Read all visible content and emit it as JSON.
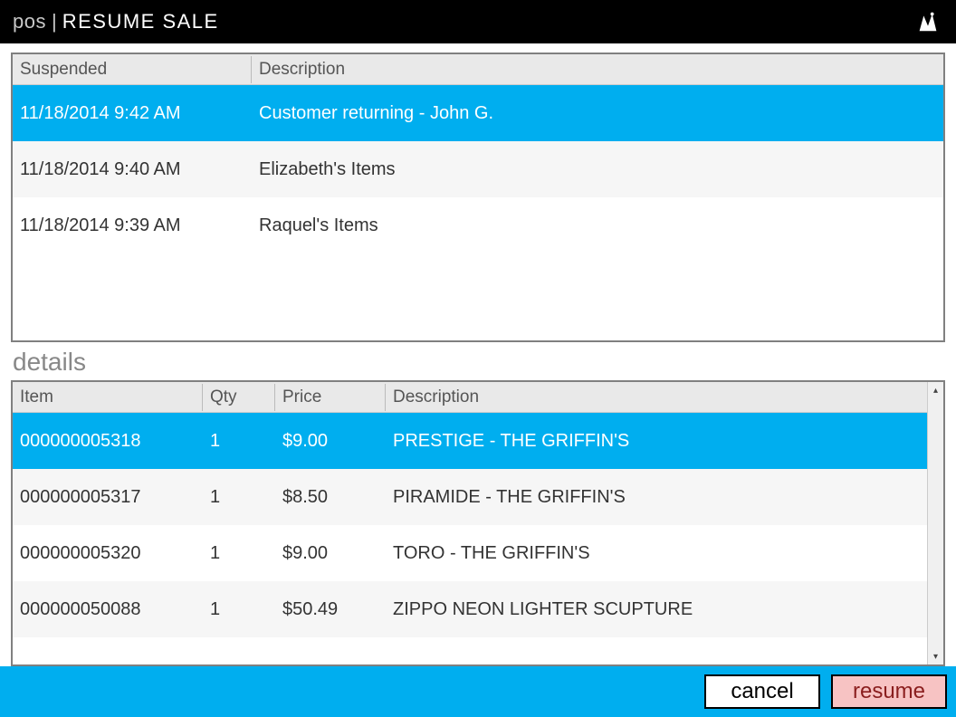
{
  "header": {
    "prefix": "pos",
    "separator": "|",
    "title": "RESUME SALE",
    "icon": "app-logo-icon"
  },
  "suspended_table": {
    "headers": {
      "suspended": "Suspended",
      "description": "Description"
    },
    "rows": [
      {
        "suspended": "11/18/2014 9:42 AM",
        "description": "Customer returning - John G.",
        "selected": true
      },
      {
        "suspended": "11/18/2014 9:40 AM",
        "description": "Elizabeth's Items",
        "selected": false
      },
      {
        "suspended": "11/18/2014 9:39 AM",
        "description": "Raquel's Items",
        "selected": false
      }
    ]
  },
  "details": {
    "label": "details",
    "headers": {
      "item": "Item",
      "qty": "Qty",
      "price": "Price",
      "description": "Description"
    },
    "rows": [
      {
        "item": "000000005318",
        "qty": "1",
        "price": "$9.00",
        "description": "PRESTIGE - THE GRIFFIN'S",
        "selected": true
      },
      {
        "item": "000000005317",
        "qty": "1",
        "price": "$8.50",
        "description": "PIRAMIDE - THE GRIFFIN'S",
        "selected": false
      },
      {
        "item": "000000005320",
        "qty": "1",
        "price": "$9.00",
        "description": "TORO - THE GRIFFIN'S",
        "selected": false
      },
      {
        "item": "000000050088",
        "qty": "1",
        "price": "$50.49",
        "description": "ZIPPO NEON LIGHTER SCUPTURE",
        "selected": false
      }
    ]
  },
  "actions": {
    "cancel": "cancel",
    "resume": "resume"
  },
  "colors": {
    "accent": "#00aeef",
    "resume_bg": "#f7c3c3",
    "resume_fg": "#8a1e1e"
  }
}
